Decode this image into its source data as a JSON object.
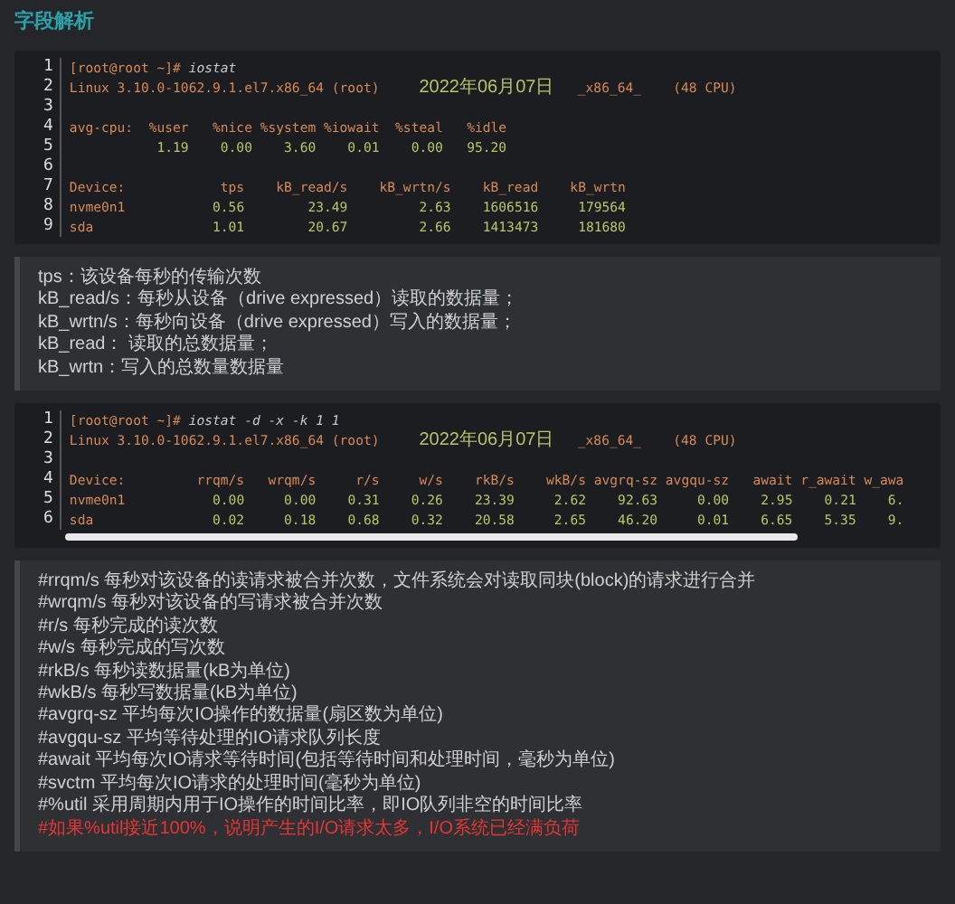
{
  "heading": "字段解析",
  "code_block_1": {
    "lines": [
      {
        "number": "1",
        "segments": [
          {
            "text": "[root@root ~]# ",
            "kind": "prompt"
          },
          {
            "text": "iostat",
            "kind": "command"
          }
        ]
      },
      {
        "number": "2",
        "segments": [
          {
            "text": "Linux 3.10.0-1062.9.1.el7.x86_64 (root)     ",
            "kind": "text"
          },
          {
            "text": "2022年06月07日",
            "kind": "value"
          },
          {
            "text": "   _x86_64_    (48 CPU)",
            "kind": "text"
          }
        ]
      },
      {
        "number": "3"
      },
      {
        "number": "4",
        "segments": [
          {
            "text": "avg-cpu:  %user   %nice %system %iowait  %steal   %idle",
            "kind": "text"
          }
        ]
      },
      {
        "number": "5",
        "segments": [
          {
            "text": "           1.19    0.00    3.60    0.01    0.00   95.20",
            "kind": "value"
          }
        ]
      },
      {
        "number": "6"
      },
      {
        "number": "7",
        "segments": [
          {
            "text": "Device:            tps    kB_read/s    kB_wrtn/s    kB_read    kB_wrtn",
            "kind": "text"
          }
        ]
      },
      {
        "number": "8",
        "segments": [
          {
            "text": "nvme0n1",
            "kind": "text"
          },
          {
            "text": "           0.56        23.49         2.63    1606516     179564",
            "kind": "value"
          }
        ]
      },
      {
        "number": "9",
        "segments": [
          {
            "text": "sda",
            "kind": "text"
          },
          {
            "text": "               1.01        20.67         2.66    1413473     181680",
            "kind": "value"
          }
        ]
      }
    ]
  },
  "note_1": {
    "lines": [
      {
        "text": "tps：该设备每秒的传输次数",
        "kind": "normal"
      },
      {
        "text": "kB_read/s：每秒从设备（drive expressed）读取的数据量；",
        "kind": "normal"
      },
      {
        "text": "kB_wrtn/s：每秒向设备（drive expressed）写入的数据量；",
        "kind": "normal"
      },
      {
        "text": "kB_read： 读取的总数据量；",
        "kind": "normal"
      },
      {
        "text": "kB_wrtn：写入的总数量数据量",
        "kind": "normal"
      }
    ]
  },
  "code_block_2": {
    "lines": [
      {
        "number": "1",
        "segments": [
          {
            "text": "[root@root ~]# ",
            "kind": "prompt"
          },
          {
            "text": "iostat -d -x -k 1 1",
            "kind": "command"
          }
        ]
      },
      {
        "number": "2",
        "segments": [
          {
            "text": "Linux 3.10.0-1062.9.1.el7.x86_64 (root)     ",
            "kind": "text"
          },
          {
            "text": "2022年06月07日",
            "kind": "value"
          },
          {
            "text": "   _x86_64_    (48 CPU)",
            "kind": "text"
          }
        ]
      },
      {
        "number": "3"
      },
      {
        "number": "4",
        "segments": [
          {
            "text": "Device:         rrqm/s   wrqm/s     r/s     w/s    rkB/s    wkB/s avgrq-sz avgqu-sz   await r_await w_awa",
            "kind": "text"
          }
        ]
      },
      {
        "number": "5",
        "segments": [
          {
            "text": "nvme0n1",
            "kind": "text"
          },
          {
            "text": "           0.00     0.00    0.31    0.26    23.39     2.62    92.63     0.00    2.95    0.21    6.",
            "kind": "value"
          }
        ]
      },
      {
        "number": "6",
        "segments": [
          {
            "text": "sda",
            "kind": "text"
          },
          {
            "text": "               0.02     0.18    0.68    0.32    20.58     2.65    46.20     0.01    6.65    5.35    9.",
            "kind": "value"
          }
        ]
      }
    ]
  },
  "note_2": {
    "lines": [
      {
        "text": "#rrqm/s 每秒对该设备的读请求被合并次数，文件系统会对读取同块(block)的请求进行合并",
        "kind": "normal"
      },
      {
        "text": "#wrqm/s 每秒对该设备的写请求被合并次数",
        "kind": "normal"
      },
      {
        "text": "#r/s 每秒完成的读次数",
        "kind": "normal"
      },
      {
        "text": "#w/s 每秒完成的写次数",
        "kind": "normal"
      },
      {
        "text": "#rkB/s 每秒读数据量(kB为单位)",
        "kind": "normal"
      },
      {
        "text": "#wkB/s 每秒写数据量(kB为单位)",
        "kind": "normal"
      },
      {
        "text": "#avgrq-sz 平均每次IO操作的数据量(扇区数为单位)",
        "kind": "normal"
      },
      {
        "text": "#avgqu-sz 平均等待处理的IO请求队列长度",
        "kind": "normal"
      },
      {
        "text": "#await 平均每次IO请求等待时间(包括等待时间和处理时间，毫秒为单位)",
        "kind": "normal"
      },
      {
        "text": "#svctm 平均每次IO请求的处理时间(毫秒为单位)",
        "kind": "normal"
      },
      {
        "text": "#%util 采用周期内用于IO操作的时间比率，即IO队列非空的时间比率",
        "kind": "normal"
      },
      {
        "text": "#如果%util接近100%，说明产生的I/O请求太多，I/O系统已经满负荷",
        "kind": "warning"
      }
    ]
  }
}
